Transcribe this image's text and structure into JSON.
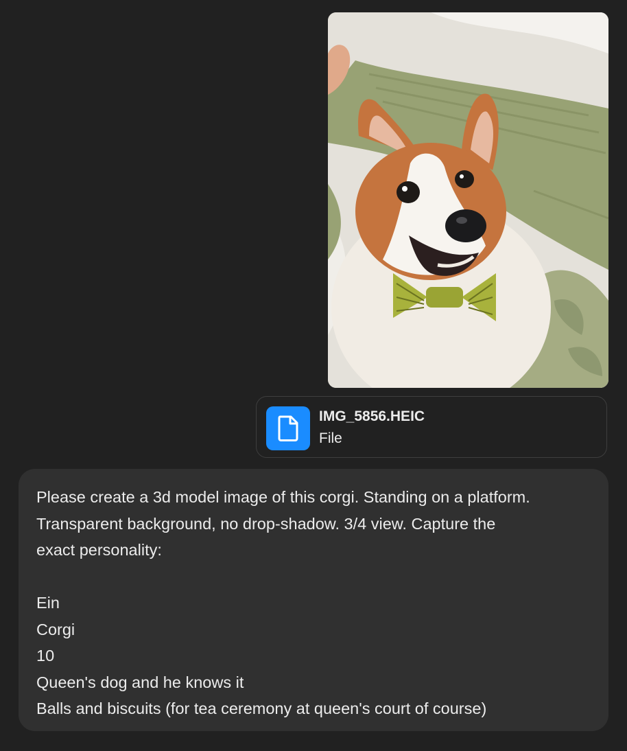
{
  "attachment_image": {
    "subject_icon": "corgi-photo",
    "colors": {
      "sheet": "#e9e6df",
      "stripe": "#98a274",
      "fur_orange": "#c5743e",
      "fur_white": "#f1ece4",
      "bowtie": "#a8b23c"
    }
  },
  "file_card": {
    "icon": "document-icon",
    "icon_bg": "#1a8cff",
    "file_name": "IMG_5856.HEIC",
    "file_type": "File"
  },
  "message": {
    "lines": [
      "Please create a 3d model image of this corgi. Standing on a platform.",
      "Transparent background, no drop-shadow. 3/4 view. Capture the",
      "exact personality:",
      "",
      "Ein",
      "Corgi",
      "10",
      "Queen's dog and he knows it",
      "Balls and biscuits (for tea ceremony at queen's court of course)"
    ]
  }
}
